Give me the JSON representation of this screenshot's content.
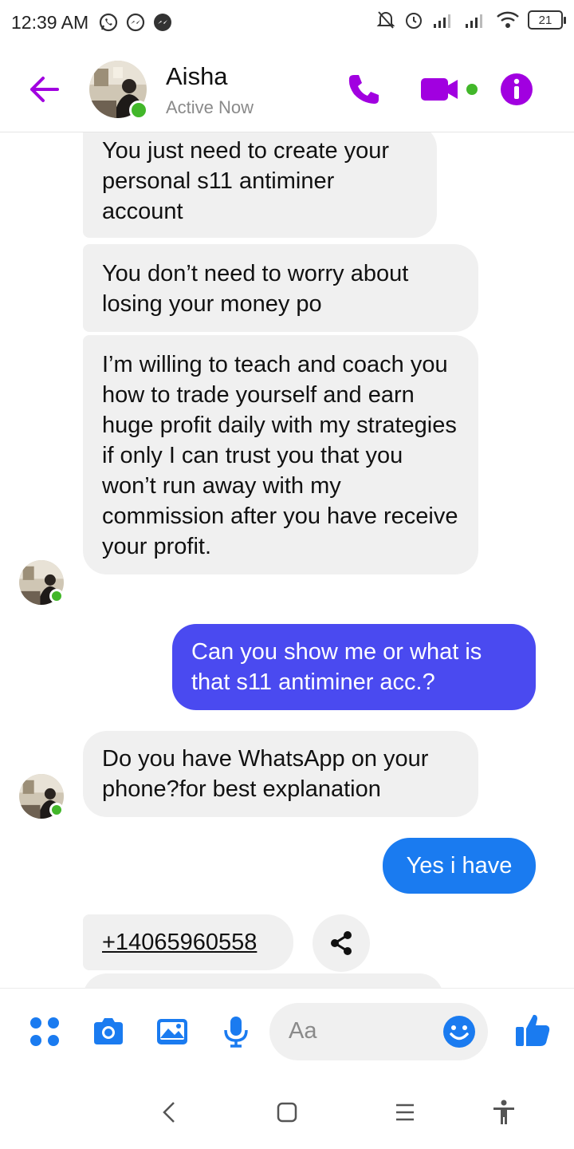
{
  "status_bar": {
    "time": "12:39 AM",
    "battery": "21",
    "icons": [
      "whatsapp-icon",
      "messenger-icon",
      "messenger-icon",
      "mute-icon",
      "alarm-icon",
      "signal-icon",
      "signal-icon",
      "wifi-icon",
      "battery-icon"
    ]
  },
  "header": {
    "contact_name": "Aisha",
    "contact_status": "Active Now",
    "accent_color": "#a100e0",
    "icons": [
      "back-arrow-icon",
      "phone-icon",
      "video-camera-icon",
      "info-icon"
    ]
  },
  "messages": [
    {
      "sender": "contact",
      "text": "You just need to create your personal s11 antiminer account"
    },
    {
      "sender": "contact",
      "text": "You don’t need to worry about losing your money po"
    },
    {
      "sender": "contact",
      "text": "I’m willing to teach and coach you how to trade yourself and earn huge profit daily with my strategies if only I can trust you that you won’t run away with my commission after you have receive your profit."
    },
    {
      "sender": "me",
      "text": "Can you show me or what is that s11 antiminer acc.?"
    },
    {
      "sender": "contact",
      "text": "Do you have WhatsApp on your phone?for best explanation"
    },
    {
      "sender": "me",
      "text": "Yes i have"
    },
    {
      "sender": "contact",
      "text": "+14065960558"
    }
  ],
  "composer": {
    "placeholder": "Aa",
    "accent_color": "#1a7bf0",
    "icons": [
      "apps-grid-icon",
      "camera-icon",
      "gallery-icon",
      "microphone-icon",
      "emoji-icon",
      "thumbs-up-icon"
    ]
  },
  "navbar": {
    "icons": [
      "nav-back-icon",
      "nav-home-icon",
      "nav-menu-icon",
      "accessibility-icon"
    ]
  }
}
